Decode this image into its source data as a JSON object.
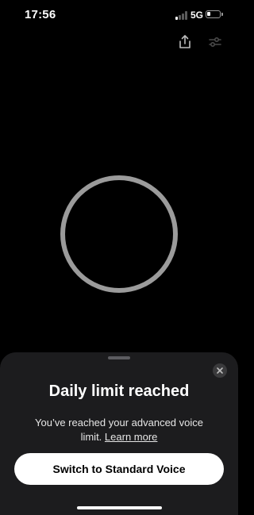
{
  "status_bar": {
    "time": "17:56",
    "network": "5G",
    "signal_bars_active": 1,
    "signal_bars_total": 4,
    "battery_level": 0.25
  },
  "toolbar": {
    "share_icon": "share-icon",
    "settings_icon": "sliders-icon"
  },
  "orb": {
    "state": "idle",
    "color": "#9b9b9b"
  },
  "sheet": {
    "title": "Daily limit reached",
    "body_text": "You’ve reached your advanced voice limit.",
    "learn_more": "Learn more",
    "primary_button": "Switch to Standard Voice",
    "close_icon": "close-icon"
  },
  "colors": {
    "background": "#000000",
    "sheet": "#1c1c1e",
    "button": "#ffffff",
    "button_text": "#000000"
  }
}
